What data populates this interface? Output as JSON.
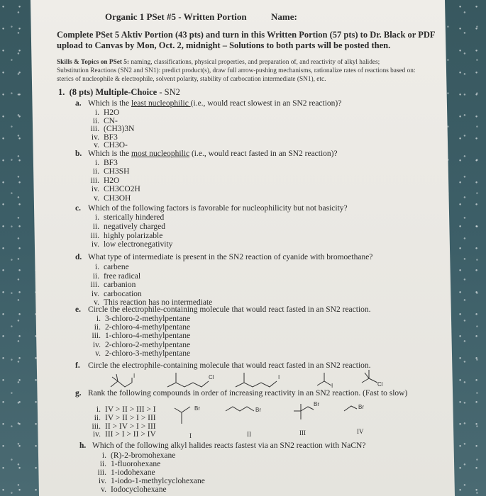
{
  "header": {
    "title": "Organic 1 PSet #5 - Written Portion",
    "name_label": "Name:"
  },
  "instructions": {
    "line1": "Complete PSet 5 Aktiv Portion (43 pts) and turn in this Written Portion (57 pts) to Dr. Black or PDF",
    "line2": "upload to Canvas by Mon, Oct. 2, midnight – Solutions to both parts will be posted then."
  },
  "skills": {
    "label": "Skills & Topics on PSet 5:",
    "line1": " naming, classifications, physical properties, and preparation of, and reactivity of alkyl halides;",
    "line2": "Substitution Reactions (SN2 and SN1): predict product(s), draw full arrow-pushing mechanisms, rationalize rates of reactions based on:",
    "line3": "sterics of nucleophile & electrophile, solvent polarity, stability of carbocation intermediate (SN1), etc."
  },
  "question1": {
    "number": "1.",
    "points": "(8 pts)",
    "heading": "Multiple-Choice",
    "topic": "- SN2",
    "parts": [
      {
        "letter": "a.",
        "prefix": "Which is the ",
        "emphasis": "least nucleophilic ",
        "suffix": "(i.e., would react slowest in an SN2 reaction)?",
        "options": [
          {
            "roman": "i.",
            "text": "H2O"
          },
          {
            "roman": "ii.",
            "text": "CN-"
          },
          {
            "roman": "iii.",
            "text": "(CH3)3N"
          },
          {
            "roman": "iv.",
            "text": "BF3"
          },
          {
            "roman": "v.",
            "text": "CH3O-"
          }
        ]
      },
      {
        "letter": "b.",
        "prefix": "Which is the ",
        "emphasis": "most nucleophilic",
        "suffix": " (i.e., would react fasted in an SN2 reaction)?",
        "options": [
          {
            "roman": "i.",
            "text": "BF3"
          },
          {
            "roman": "ii.",
            "text": "CH3SH"
          },
          {
            "roman": "iii.",
            "text": "H2O"
          },
          {
            "roman": "iv.",
            "text": "CH3CO2H"
          },
          {
            "roman": "v.",
            "text": "CH3OH"
          }
        ]
      },
      {
        "letter": "c.",
        "text": "Which of the following factors is favorable for nucleophilicity but not basicity?",
        "options": [
          {
            "roman": "i.",
            "text": "sterically hindered"
          },
          {
            "roman": "ii.",
            "text": "negatively charged"
          },
          {
            "roman": "iii.",
            "text": "highly polarizable"
          },
          {
            "roman": "iv.",
            "text": "low electronegativity"
          }
        ]
      },
      {
        "letter": "d.",
        "text": "What type of intermediate is present in the SN2 reaction of cyanide with bromoethane?",
        "options": [
          {
            "roman": "i.",
            "text": "carbene"
          },
          {
            "roman": "ii.",
            "text": "free radical"
          },
          {
            "roman": "iii.",
            "text": "carbanion"
          },
          {
            "roman": "iv.",
            "text": "carbocation"
          },
          {
            "roman": "v.",
            "text": "This reaction has no intermediate"
          }
        ]
      },
      {
        "letter": "e.",
        "text": "Circle the electrophile-containing molecule that would react fasted in an SN2 reaction.",
        "options": [
          {
            "roman": "i.",
            "text": "3-chloro-2-methylpentane"
          },
          {
            "roman": "ii.",
            "text": "2-chloro-4-methylpentane"
          },
          {
            "roman": "iii.",
            "text": "1-chloro-4-methylpentane"
          },
          {
            "roman": "iv.",
            "text": "2-chloro-2-methylpentane"
          },
          {
            "roman": "v.",
            "text": "2-chloro-3-methylpentane"
          }
        ]
      },
      {
        "letter": "f.",
        "text": "Circle the electrophile-containing molecule that would react fasted in an SN2 reaction.",
        "structures": [
          {
            "halogen": "I"
          },
          {
            "halogen": "Cl"
          },
          {
            "halogen": "I"
          },
          {
            "halogen": "I"
          },
          {
            "halogen": "Cl"
          }
        ]
      },
      {
        "letter": "g.",
        "text": "Rank the following compounds in order of increasing reactivity in an SN2 reaction. (Fast to slow)",
        "options": [
          {
            "roman": "i.",
            "text": "IV > II > III > I"
          },
          {
            "roman": "ii.",
            "text": "IV > II > I > III"
          },
          {
            "roman": "iii.",
            "text": "II > IV > I > III"
          },
          {
            "roman": "iv.",
            "text": "III > I > II > IV"
          }
        ],
        "structures": [
          {
            "label": "I",
            "halogen": "Br"
          },
          {
            "label": "II",
            "halogen": "Br"
          },
          {
            "label": "III",
            "halogen": "Br"
          },
          {
            "label": "IV",
            "halogen": "Br"
          }
        ]
      },
      {
        "letter": "h.",
        "text": "Which of the following alkyl halides reacts fastest via an SN2 reaction with NaCN?",
        "options": [
          {
            "roman": "i.",
            "text": "(R)-2-bromohexane"
          },
          {
            "roman": "ii.",
            "text": "1-fluorohexane"
          },
          {
            "roman": "iii.",
            "text": "1-iodohexane"
          },
          {
            "roman": "iv.",
            "text": "1-iodo-1-methylcyclohexane"
          },
          {
            "roman": "v.",
            "text": "Iodocyclohexane"
          }
        ]
      }
    ]
  }
}
